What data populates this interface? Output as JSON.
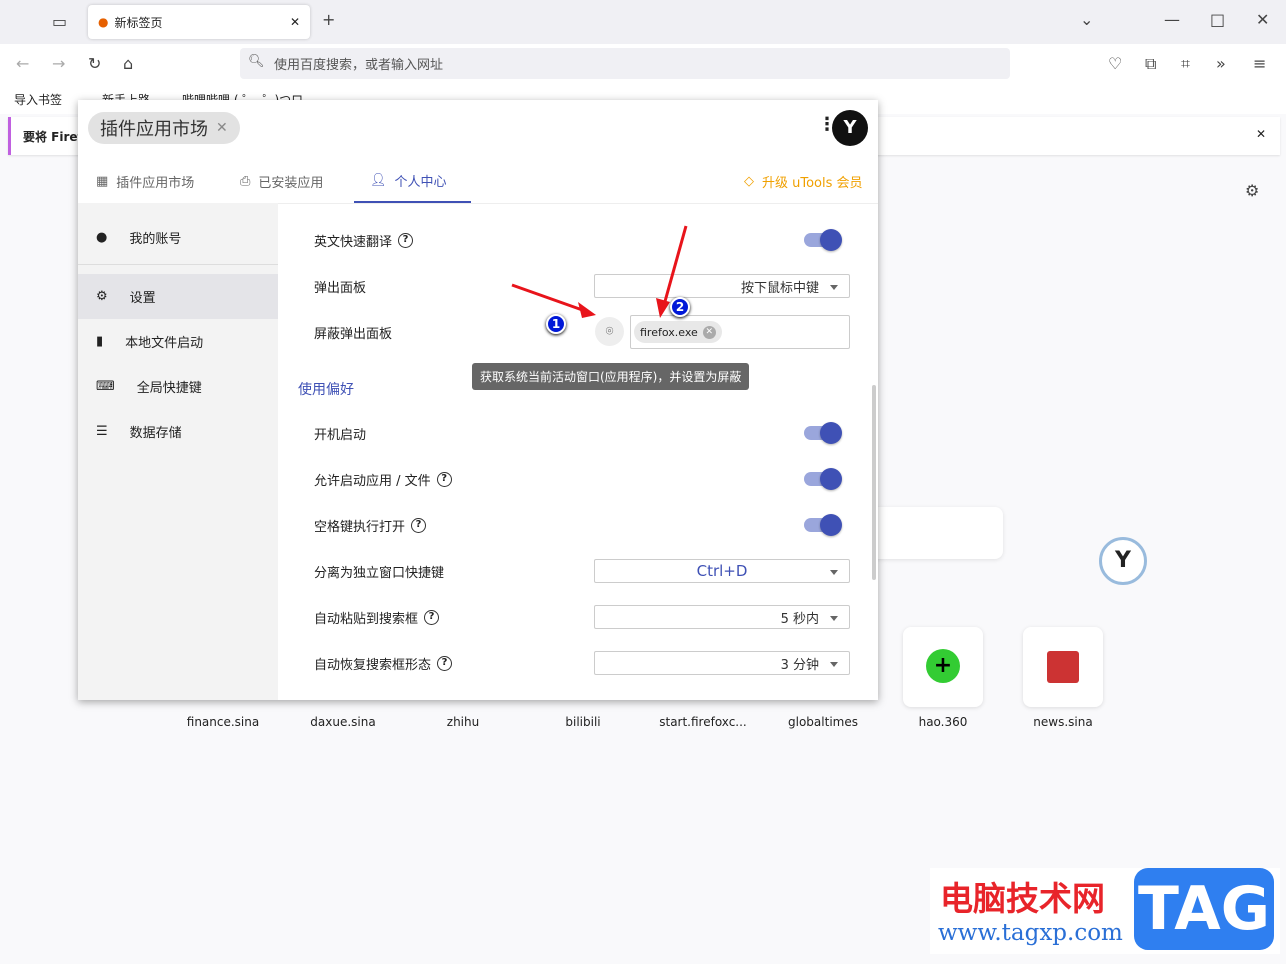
{
  "browser": {
    "tab_title": "新标签页",
    "url_placeholder": "使用百度搜索，或者输入网址",
    "bookmarks": [
      "导入书签",
      "新手上路",
      "哔哩哔哩 ( ゜- ゜)つロ"
    ],
    "notification": "要将 Firef"
  },
  "popup": {
    "chip": "插件应用市场",
    "tabs": [
      {
        "label": "插件应用市场",
        "icon": "grid-icon"
      },
      {
        "label": "已安装应用",
        "icon": "download-monitor-icon"
      },
      {
        "label": "个人中心",
        "icon": "user-gear-icon",
        "active": true
      }
    ],
    "upgrade": "升级 uTools 会员",
    "sidebar": [
      {
        "label": "我的账号",
        "icon": "account-icon"
      },
      {
        "label": "设置",
        "icon": "gear-icon",
        "active": true
      },
      {
        "label": "本地文件启动",
        "icon": "file-icon"
      },
      {
        "label": "全局快捷键",
        "icon": "keyboard-icon"
      },
      {
        "label": "数据存储",
        "icon": "storage-icon"
      }
    ],
    "settings": {
      "translate": {
        "label": "英文快速翻译",
        "on": true
      },
      "popup_panel": {
        "label": "弹出面板",
        "value": "按下鼠标中键"
      },
      "block_panel": {
        "label": "屏蔽弹出面板",
        "tag": "firefox.exe"
      },
      "tooltip": "获取系统当前活动窗口(应用程序)，并设置为屏蔽",
      "section": "使用偏好",
      "autostart": {
        "label": "开机启动",
        "on": true
      },
      "allow_launch": {
        "label": "允许启动应用 / 文件",
        "on": true
      },
      "space_open": {
        "label": "空格键执行打开",
        "on": true
      },
      "detach": {
        "label": "分离为独立窗口快捷键",
        "value": "Ctrl+D"
      },
      "autopaste": {
        "label": "自动粘贴到搜索框",
        "value": "5 秒内"
      },
      "restore": {
        "label": "自动恢复搜索框形态",
        "value": "3 分钟"
      }
    },
    "accent": "#3f51b5"
  },
  "annotations": [
    "1",
    "2"
  ],
  "shortcuts": [
    "finance.sina",
    "daxue.sina",
    "zhihu",
    "bilibili",
    "start.firefoxc...",
    "globaltimes",
    "hao.360",
    "news.sina"
  ],
  "watermark": {
    "title": "电脑技术网",
    "url": "www.tagxp.com",
    "logo": "TAG"
  }
}
